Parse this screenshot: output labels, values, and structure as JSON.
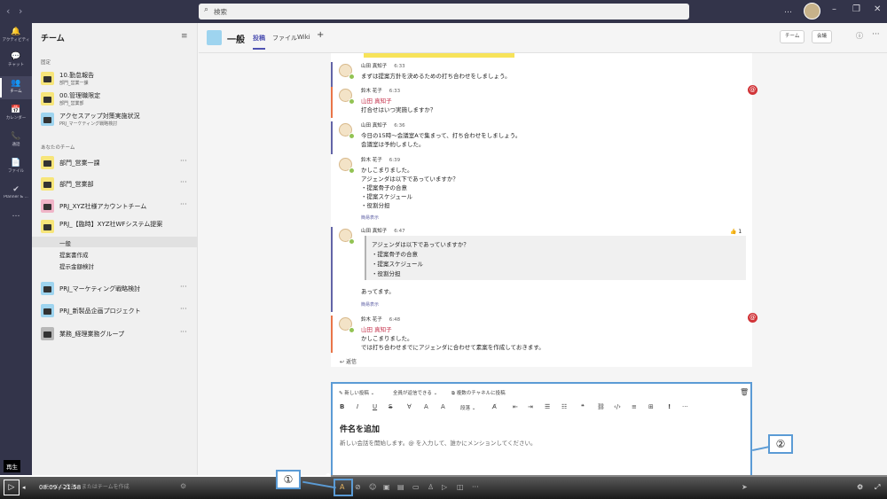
{
  "search": {
    "placeholder": "検索"
  },
  "rail": [
    {
      "icon": "bell-icon",
      "glyph": "🔔",
      "label": "アクティビティ"
    },
    {
      "icon": "chat-icon",
      "glyph": "💬",
      "label": "チャット"
    },
    {
      "icon": "teams-icon",
      "glyph": "👥",
      "label": "チーム"
    },
    {
      "icon": "calendar-icon",
      "glyph": "📅",
      "label": "カレンダー"
    },
    {
      "icon": "phone-icon",
      "glyph": "📞",
      "label": "通話"
    },
    {
      "icon": "file-icon",
      "glyph": "📄",
      "label": "ファイル"
    },
    {
      "icon": "planner-icon",
      "glyph": "✔",
      "label": "Planner & ..."
    },
    {
      "icon": "more-icon",
      "glyph": "…",
      "label": ""
    }
  ],
  "teams_panel": {
    "title": "チーム",
    "pinned_label": "固定",
    "pinned": [
      {
        "name": "10.勤怠報告",
        "sub": "部門_営業一課"
      },
      {
        "name": "00.管理職限定",
        "sub": "部門_営業部"
      },
      {
        "name": "アクセスアップ対策実施状況",
        "sub": "PRJ_マーケティング戦略検討"
      }
    ],
    "yours_label": "あなたのチーム",
    "teams": [
      {
        "name": "部門_営業一課"
      },
      {
        "name": "部門_営業部"
      },
      {
        "name": "PRJ_XYZ社様アカウントチーム"
      },
      {
        "name": "PRJ_【臨時】XYZ社WFシステム提案"
      },
      {
        "name": "PRJ_マーケティング戦略検討"
      },
      {
        "name": "PRJ_新製品企画プロジェクト"
      },
      {
        "name": "業務_経理業務グループ"
      }
    ],
    "channels": [
      "一般",
      "提案書作成",
      "提示金額検討"
    ]
  },
  "channel": {
    "title": "一般",
    "tabs": [
      "投稿",
      "ファイル",
      "Wiki"
    ],
    "team_btn": "チーム",
    "meet_btn": "会議"
  },
  "messages": [
    {
      "author": "山田 真知子",
      "time": "6:33",
      "lines": [
        "まずは提案方針を決めるための打ち合わせをしましょう。"
      ]
    },
    {
      "author": "鈴木 花子",
      "time": "6:33",
      "mention": "山田 真知子",
      "lines": [
        "打合せはいつ実施しますか？"
      ]
    },
    {
      "author": "山田 真知子",
      "time": "6:36",
      "lines": [
        "今日の15時～会議室Aで集まって、打ち合わせをしましょう。",
        "会議室は予約しました。"
      ]
    },
    {
      "author": "鈴木 花子",
      "time": "6:39",
      "lines": [
        "かしこまりました。",
        "アジェンダは以下であっていますか？",
        "・提案骨子の合意",
        "・提案スケジュール",
        "・役割分担"
      ],
      "link": "簡易表示"
    },
    {
      "author": "山田 真知子",
      "time": "6:47",
      "likes": "1",
      "quote": [
        "アジェンダは以下であっていますか？",
        "・提案骨子の合意",
        "・提案スケジュール",
        "・役割分担"
      ],
      "after": "あってます。",
      "link": "簡易表示"
    },
    {
      "author": "鈴木 花子",
      "time": "6:48",
      "mention": "山田 真知子",
      "lines": [
        "かしこまりました。",
        "では打ち合わせまでにアジェンダに合わせて素案を作成しておきます。"
      ]
    }
  ],
  "reply": "返信",
  "composer": {
    "new_post": "新しい投稿",
    "everyone": "全員が返信できる",
    "multi": "複数のチャネルに投稿",
    "paragraph": "段落",
    "subject": "件名を追加",
    "placeholder": "新しい会話を開始します。@ を入力して、誰かにメンションしてください。"
  },
  "callouts": [
    "①",
    "②"
  ],
  "player": {
    "time": "08:09 / 21:58",
    "tooltip": "再生",
    "play": "▷",
    "team_join": "チームに参加、またはチームを作成"
  }
}
